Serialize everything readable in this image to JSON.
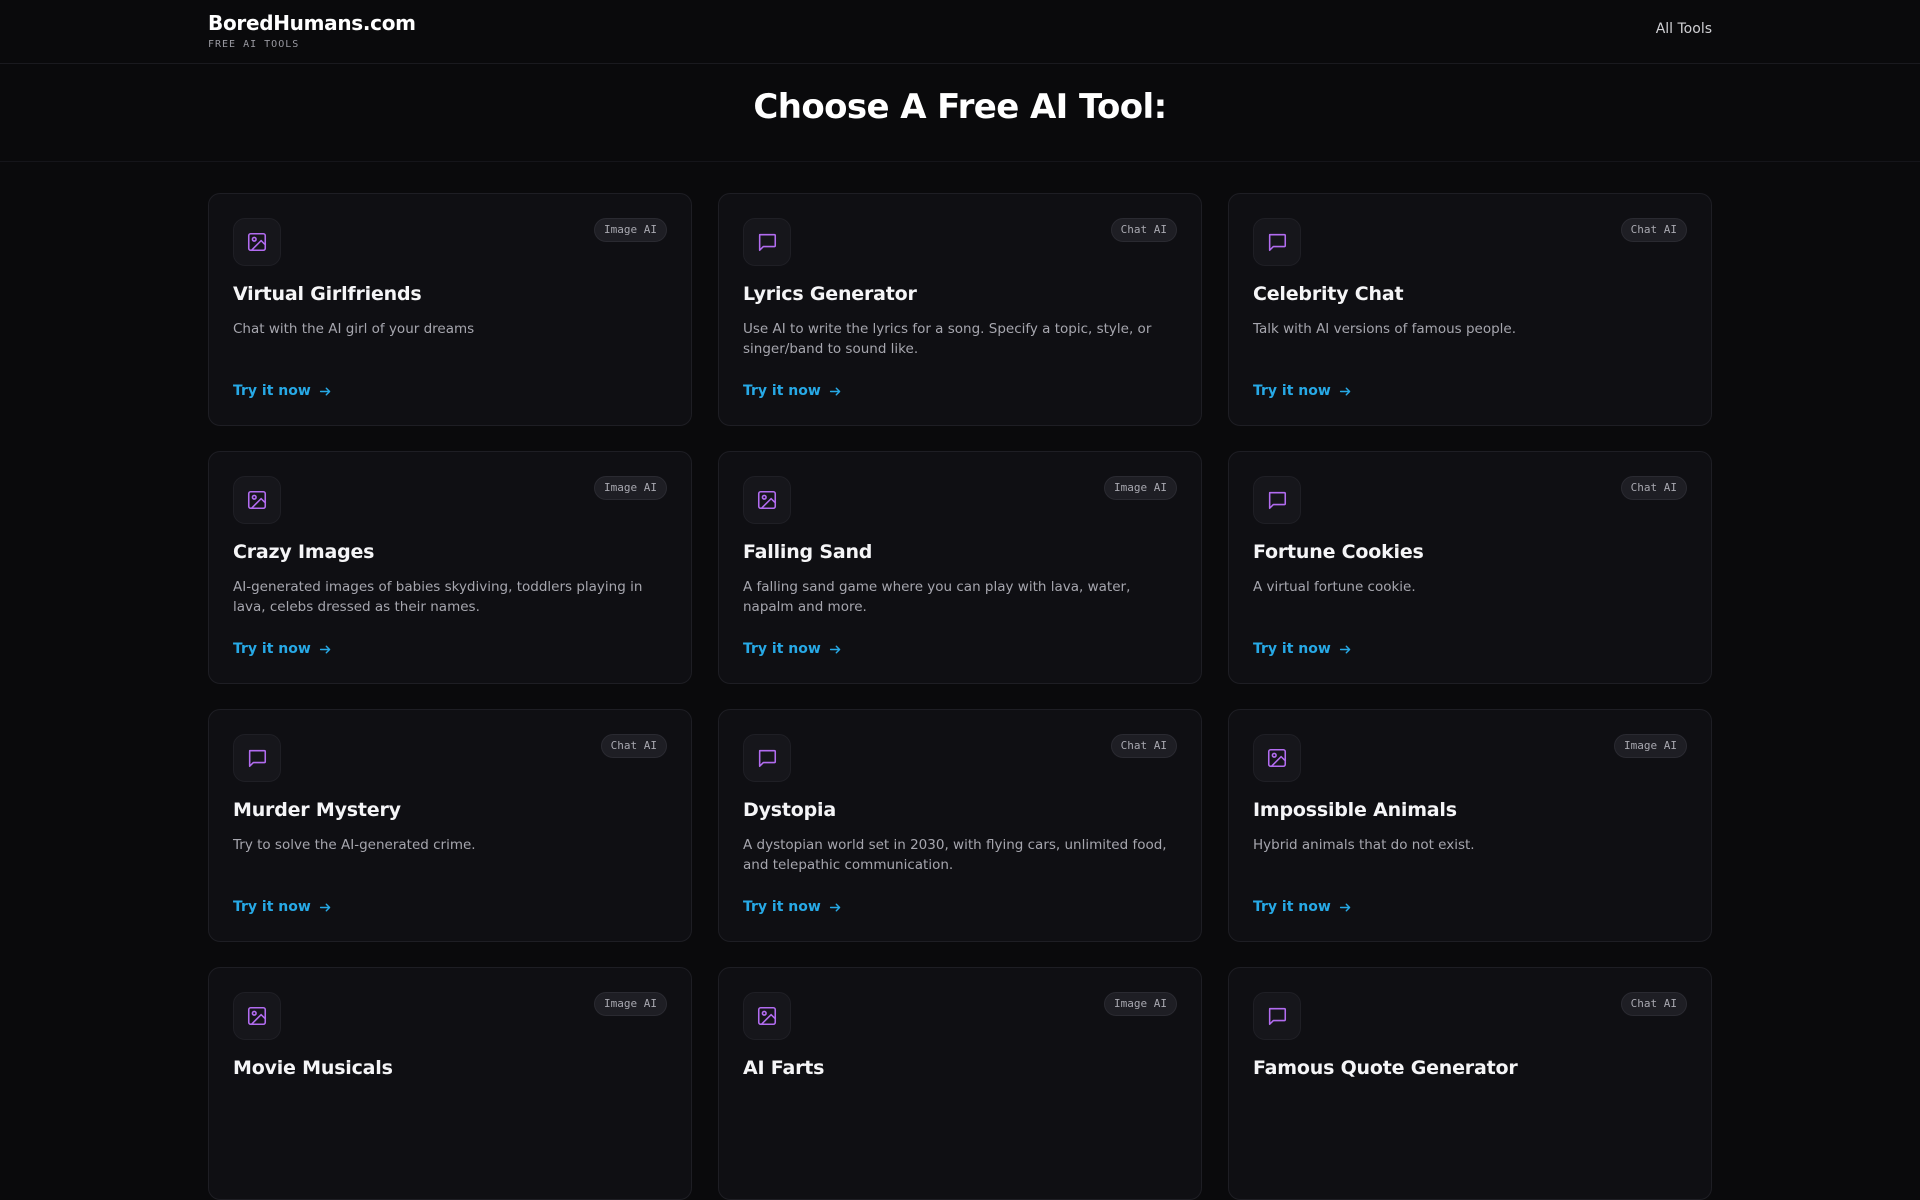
{
  "header": {
    "brand_name": "BoredHumans.com",
    "brand_subtitle": "FREE AI TOOLS",
    "nav_all_tools": "All Tools"
  },
  "hero": {
    "title": "Choose A Free AI Tool:"
  },
  "colors": {
    "accent_link": "#27a9e6",
    "icon_purple": "#b26cf0",
    "background": "#0a0a0c"
  },
  "cards": [
    {
      "icon": "image-icon",
      "badge": "Image AI",
      "title": "Virtual Girlfriends",
      "description": "Chat with the AI girl of your dreams",
      "cta": "Try it now"
    },
    {
      "icon": "chat-icon",
      "badge": "Chat AI",
      "title": "Lyrics Generator",
      "description": "Use AI to write the lyrics for a song. Specify a topic, style, or singer/band to sound like.",
      "cta": "Try it now"
    },
    {
      "icon": "chat-icon",
      "badge": "Chat AI",
      "title": "Celebrity Chat",
      "description": "Talk with AI versions of famous people.",
      "cta": "Try it now"
    },
    {
      "icon": "image-icon",
      "badge": "Image AI",
      "title": "Crazy Images",
      "description": "AI-generated images of babies skydiving, toddlers playing in lava, celebs dressed as their names.",
      "cta": "Try it now"
    },
    {
      "icon": "image-icon",
      "badge": "Image AI",
      "title": "Falling Sand",
      "description": "A falling sand game where you can play with lava, water, napalm and more.",
      "cta": "Try it now"
    },
    {
      "icon": "chat-icon",
      "badge": "Chat AI",
      "title": "Fortune Cookies",
      "description": "A virtual fortune cookie.",
      "cta": "Try it now"
    },
    {
      "icon": "chat-icon",
      "badge": "Chat AI",
      "title": "Murder Mystery",
      "description": "Try to solve the AI-generated crime.",
      "cta": "Try it now"
    },
    {
      "icon": "chat-icon",
      "badge": "Chat AI",
      "title": "Dystopia",
      "description": "A dystopian world set in 2030, with flying cars, unlimited food, and telepathic communication.",
      "cta": "Try it now"
    },
    {
      "icon": "image-icon",
      "badge": "Image AI",
      "title": "Impossible Animals",
      "description": "Hybrid animals that do not exist.",
      "cta": "Try it now"
    },
    {
      "icon": "image-icon",
      "badge": "Image AI",
      "title": "Movie Musicals",
      "description": "",
      "cta": ""
    },
    {
      "icon": "image-icon",
      "badge": "Image AI",
      "title": "AI Farts",
      "description": "",
      "cta": ""
    },
    {
      "icon": "chat-icon",
      "badge": "Chat AI",
      "title": "Famous Quote Generator",
      "description": "",
      "cta": ""
    }
  ]
}
